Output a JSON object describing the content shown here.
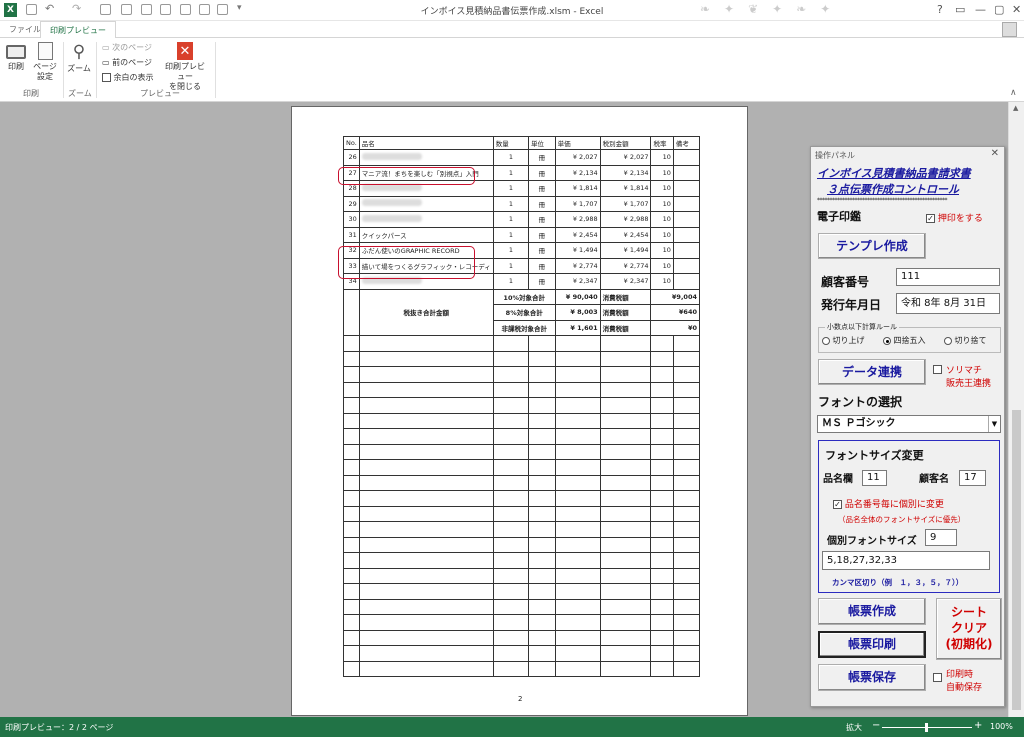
{
  "window": {
    "title": "インボイス見積納品書伝票作成.xlsm - Excel"
  },
  "tabs": {
    "file": "ファイル",
    "print_preview": "印刷プレビュー"
  },
  "ribbon": {
    "print": "印刷",
    "page_setup_1": "ページ",
    "page_setup_2": "設定",
    "zoom": "ズーム",
    "next_page": "次のページ",
    "prev_page": "前のページ",
    "show_margins": "余白の表示",
    "close_preview_1": "印刷プレビュー",
    "close_preview_2": "を閉じる",
    "group_print": "印刷",
    "group_zoom": "ズーム",
    "group_preview": "プレビュー"
  },
  "sheet": {
    "headers": {
      "no": "No.",
      "name": "品名",
      "qty": "数量",
      "unit": "単位",
      "price": "単価",
      "excl": "税別金額",
      "rate": "税率",
      "note": "備考"
    },
    "rows": [
      {
        "no": "26",
        "name": "",
        "qty": "1",
        "unit": "冊",
        "price": "¥ 2,027",
        "excl": "¥ 2,027",
        "rate": "10"
      },
      {
        "no": "27",
        "name": "マニア流！まちを楽しむ「別視点」入門",
        "qty": "1",
        "unit": "冊",
        "price": "¥ 2,134",
        "excl": "¥ 2,134",
        "rate": "10"
      },
      {
        "no": "28",
        "name": "",
        "qty": "1",
        "unit": "冊",
        "price": "¥ 1,814",
        "excl": "¥ 1,814",
        "rate": "10"
      },
      {
        "no": "29",
        "name": "",
        "qty": "1",
        "unit": "冊",
        "price": "¥ 1,707",
        "excl": "¥ 1,707",
        "rate": "10"
      },
      {
        "no": "30",
        "name": "",
        "qty": "1",
        "unit": "冊",
        "price": "¥ 2,988",
        "excl": "¥ 2,988",
        "rate": "10"
      },
      {
        "no": "31",
        "name": "クイックパース",
        "qty": "1",
        "unit": "冊",
        "price": "¥ 2,454",
        "excl": "¥ 2,454",
        "rate": "10"
      },
      {
        "no": "32",
        "name": "ふだん使いのGRAPHIC RECORD",
        "qty": "1",
        "unit": "冊",
        "price": "¥ 1,494",
        "excl": "¥ 1,494",
        "rate": "10"
      },
      {
        "no": "33",
        "name": "描いて場をつくるグラフィック・レコーディ",
        "qty": "1",
        "unit": "冊",
        "price": "¥ 2,774",
        "excl": "¥ 2,774",
        "rate": "10"
      },
      {
        "no": "34",
        "name": "",
        "qty": "1",
        "unit": "冊",
        "price": "¥ 2,347",
        "excl": "¥ 2,347",
        "rate": "10"
      }
    ],
    "summary": {
      "label": "税抜き合計金額",
      "rows": [
        {
          "l": "10%対象合計",
          "v": "¥ 90,040",
          "tl": "消費税額",
          "tv": "¥9,004"
        },
        {
          "l": "8%対象合計",
          "v": "¥ 8,003",
          "tl": "消費税額",
          "tv": "¥640"
        },
        {
          "l": "非課税対象合計",
          "v": "¥ 1,601",
          "tl": "消費税額",
          "tv": "¥0"
        }
      ]
    },
    "page_number": "2"
  },
  "panel": {
    "title": "操作パネル",
    "heading1": "インボイス見積書納品書請求書",
    "heading2": "３点伝票作成コントロール",
    "stars": "****************************************************",
    "stamp_label": "電子印鑑",
    "stamp_check": "押印をする",
    "template_btn": "テンプレ作成",
    "customer_no_label": "顧客番号",
    "customer_no": "111",
    "issue_date_label": "発行年月日",
    "issue_date": "令和 8年 8月 31日",
    "rounding_label": "小数点以下計算ルール",
    "round_up": "切り上げ",
    "round_half": "四捨五入",
    "round_down": "切り捨て",
    "data_link_btn": "データ連携",
    "sorimachi_1": "ソリマチ",
    "sorimachi_2": "販売王連携",
    "font_select_label": "フォントの選択",
    "font_value": "ＭＳ Ｐゴシック",
    "font_size_title": "フォントサイズ変更",
    "name_col_label": "品名欄",
    "name_col_size": "11",
    "customer_name_label": "顧客名",
    "customer_name_size": "17",
    "per_item_check": "品名番号毎に個別に変更",
    "priority_note": "（品名全体のフォントサイズに優先）",
    "indiv_size_label": "個別フォントサイズ",
    "indiv_size": "9",
    "item_list": "5,18,27,32,33",
    "comma_note": "カンマ区切り（例　１，３，５，７））",
    "create_btn": "帳票作成",
    "print_btn": "帳票印刷",
    "save_btn": "帳票保存",
    "clear_1": "シート",
    "clear_2": "クリア",
    "clear_3": "(初期化)",
    "auto_save_1": "印刷時",
    "auto_save_2": "自動保存"
  },
  "status": {
    "left": "印刷プレビュー：2 / 2 ページ",
    "zoom_label": "拡大",
    "zoom_pct": "100%"
  }
}
